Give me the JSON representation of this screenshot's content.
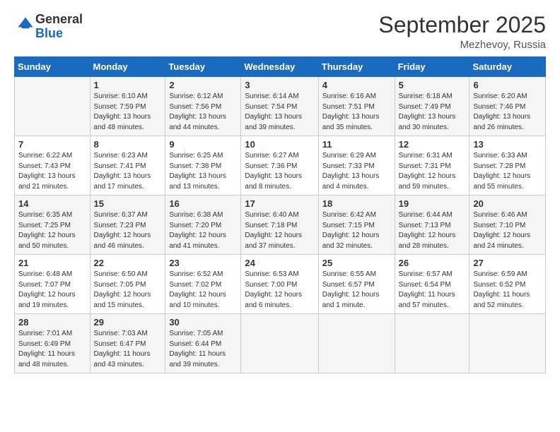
{
  "header": {
    "logo_general": "General",
    "logo_blue": "Blue",
    "month": "September 2025",
    "location": "Mezhevoy, Russia"
  },
  "days_of_week": [
    "Sunday",
    "Monday",
    "Tuesday",
    "Wednesday",
    "Thursday",
    "Friday",
    "Saturday"
  ],
  "weeks": [
    [
      {
        "num": "",
        "sunrise": "",
        "sunset": "",
        "daylight": ""
      },
      {
        "num": "1",
        "sunrise": "Sunrise: 6:10 AM",
        "sunset": "Sunset: 7:59 PM",
        "daylight": "Daylight: 13 hours and 48 minutes."
      },
      {
        "num": "2",
        "sunrise": "Sunrise: 6:12 AM",
        "sunset": "Sunset: 7:56 PM",
        "daylight": "Daylight: 13 hours and 44 minutes."
      },
      {
        "num": "3",
        "sunrise": "Sunrise: 6:14 AM",
        "sunset": "Sunset: 7:54 PM",
        "daylight": "Daylight: 13 hours and 39 minutes."
      },
      {
        "num": "4",
        "sunrise": "Sunrise: 6:16 AM",
        "sunset": "Sunset: 7:51 PM",
        "daylight": "Daylight: 13 hours and 35 minutes."
      },
      {
        "num": "5",
        "sunrise": "Sunrise: 6:18 AM",
        "sunset": "Sunset: 7:49 PM",
        "daylight": "Daylight: 13 hours and 30 minutes."
      },
      {
        "num": "6",
        "sunrise": "Sunrise: 6:20 AM",
        "sunset": "Sunset: 7:46 PM",
        "daylight": "Daylight: 13 hours and 26 minutes."
      }
    ],
    [
      {
        "num": "7",
        "sunrise": "Sunrise: 6:22 AM",
        "sunset": "Sunset: 7:43 PM",
        "daylight": "Daylight: 13 hours and 21 minutes."
      },
      {
        "num": "8",
        "sunrise": "Sunrise: 6:23 AM",
        "sunset": "Sunset: 7:41 PM",
        "daylight": "Daylight: 13 hours and 17 minutes."
      },
      {
        "num": "9",
        "sunrise": "Sunrise: 6:25 AM",
        "sunset": "Sunset: 7:38 PM",
        "daylight": "Daylight: 13 hours and 13 minutes."
      },
      {
        "num": "10",
        "sunrise": "Sunrise: 6:27 AM",
        "sunset": "Sunset: 7:36 PM",
        "daylight": "Daylight: 13 hours and 8 minutes."
      },
      {
        "num": "11",
        "sunrise": "Sunrise: 6:29 AM",
        "sunset": "Sunset: 7:33 PM",
        "daylight": "Daylight: 13 hours and 4 minutes."
      },
      {
        "num": "12",
        "sunrise": "Sunrise: 6:31 AM",
        "sunset": "Sunset: 7:31 PM",
        "daylight": "Daylight: 12 hours and 59 minutes."
      },
      {
        "num": "13",
        "sunrise": "Sunrise: 6:33 AM",
        "sunset": "Sunset: 7:28 PM",
        "daylight": "Daylight: 12 hours and 55 minutes."
      }
    ],
    [
      {
        "num": "14",
        "sunrise": "Sunrise: 6:35 AM",
        "sunset": "Sunset: 7:25 PM",
        "daylight": "Daylight: 12 hours and 50 minutes."
      },
      {
        "num": "15",
        "sunrise": "Sunrise: 6:37 AM",
        "sunset": "Sunset: 7:23 PM",
        "daylight": "Daylight: 12 hours and 46 minutes."
      },
      {
        "num": "16",
        "sunrise": "Sunrise: 6:38 AM",
        "sunset": "Sunset: 7:20 PM",
        "daylight": "Daylight: 12 hours and 41 minutes."
      },
      {
        "num": "17",
        "sunrise": "Sunrise: 6:40 AM",
        "sunset": "Sunset: 7:18 PM",
        "daylight": "Daylight: 12 hours and 37 minutes."
      },
      {
        "num": "18",
        "sunrise": "Sunrise: 6:42 AM",
        "sunset": "Sunset: 7:15 PM",
        "daylight": "Daylight: 12 hours and 32 minutes."
      },
      {
        "num": "19",
        "sunrise": "Sunrise: 6:44 AM",
        "sunset": "Sunset: 7:13 PM",
        "daylight": "Daylight: 12 hours and 28 minutes."
      },
      {
        "num": "20",
        "sunrise": "Sunrise: 6:46 AM",
        "sunset": "Sunset: 7:10 PM",
        "daylight": "Daylight: 12 hours and 24 minutes."
      }
    ],
    [
      {
        "num": "21",
        "sunrise": "Sunrise: 6:48 AM",
        "sunset": "Sunset: 7:07 PM",
        "daylight": "Daylight: 12 hours and 19 minutes."
      },
      {
        "num": "22",
        "sunrise": "Sunrise: 6:50 AM",
        "sunset": "Sunset: 7:05 PM",
        "daylight": "Daylight: 12 hours and 15 minutes."
      },
      {
        "num": "23",
        "sunrise": "Sunrise: 6:52 AM",
        "sunset": "Sunset: 7:02 PM",
        "daylight": "Daylight: 12 hours and 10 minutes."
      },
      {
        "num": "24",
        "sunrise": "Sunrise: 6:53 AM",
        "sunset": "Sunset: 7:00 PM",
        "daylight": "Daylight: 12 hours and 6 minutes."
      },
      {
        "num": "25",
        "sunrise": "Sunrise: 6:55 AM",
        "sunset": "Sunset: 6:57 PM",
        "daylight": "Daylight: 12 hours and 1 minute."
      },
      {
        "num": "26",
        "sunrise": "Sunrise: 6:57 AM",
        "sunset": "Sunset: 6:54 PM",
        "daylight": "Daylight: 11 hours and 57 minutes."
      },
      {
        "num": "27",
        "sunrise": "Sunrise: 6:59 AM",
        "sunset": "Sunset: 6:52 PM",
        "daylight": "Daylight: 11 hours and 52 minutes."
      }
    ],
    [
      {
        "num": "28",
        "sunrise": "Sunrise: 7:01 AM",
        "sunset": "Sunset: 6:49 PM",
        "daylight": "Daylight: 11 hours and 48 minutes."
      },
      {
        "num": "29",
        "sunrise": "Sunrise: 7:03 AM",
        "sunset": "Sunset: 6:47 PM",
        "daylight": "Daylight: 11 hours and 43 minutes."
      },
      {
        "num": "30",
        "sunrise": "Sunrise: 7:05 AM",
        "sunset": "Sunset: 6:44 PM",
        "daylight": "Daylight: 11 hours and 39 minutes."
      },
      {
        "num": "",
        "sunrise": "",
        "sunset": "",
        "daylight": ""
      },
      {
        "num": "",
        "sunrise": "",
        "sunset": "",
        "daylight": ""
      },
      {
        "num": "",
        "sunrise": "",
        "sunset": "",
        "daylight": ""
      },
      {
        "num": "",
        "sunrise": "",
        "sunset": "",
        "daylight": ""
      }
    ]
  ]
}
